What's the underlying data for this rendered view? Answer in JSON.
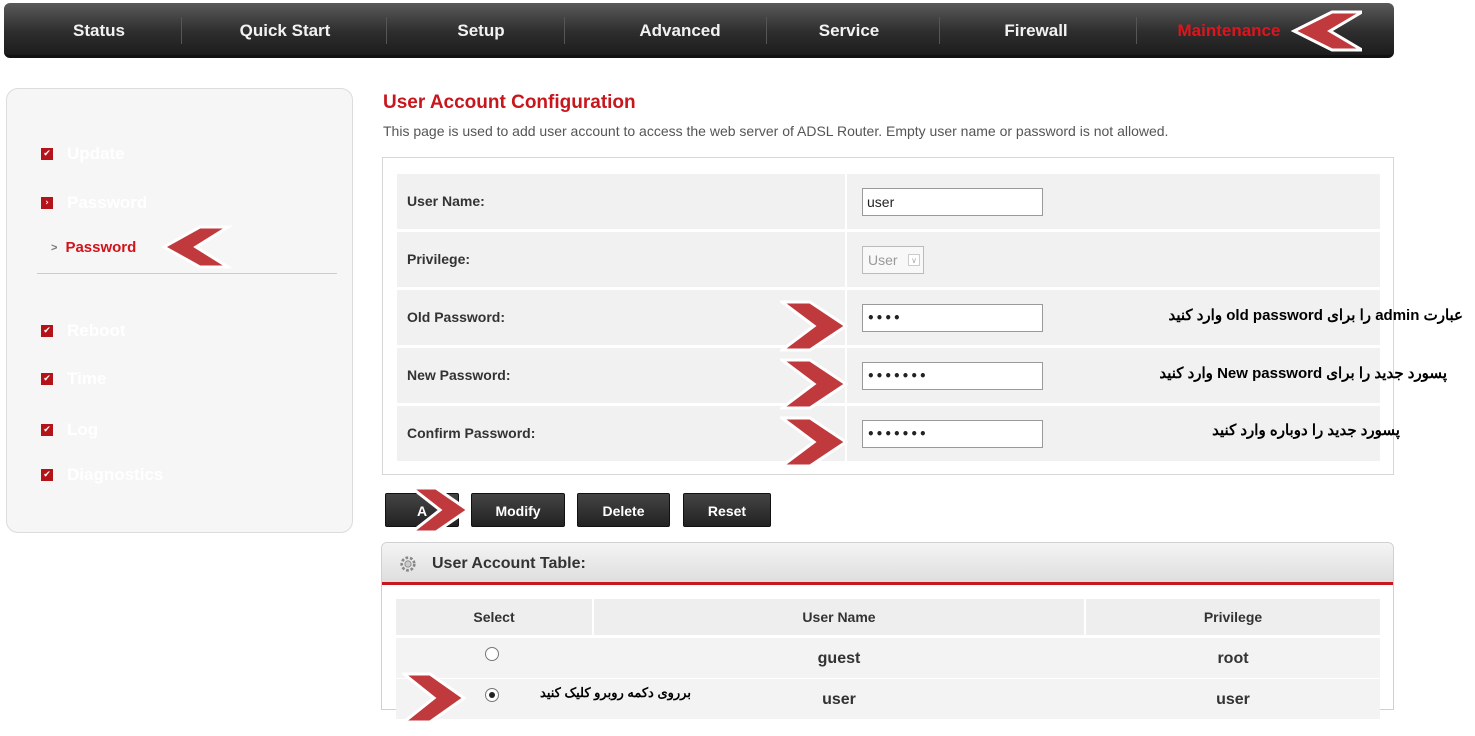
{
  "nav": {
    "items": [
      {
        "label": "Status"
      },
      {
        "label": "Quick Start"
      },
      {
        "label": "Setup"
      },
      {
        "label": "Advanced"
      },
      {
        "label": "Service"
      },
      {
        "label": "Firewall"
      },
      {
        "label": "Maintenance",
        "active": true
      }
    ]
  },
  "sidebar": {
    "items": [
      {
        "label": "Update"
      },
      {
        "label": "Password"
      },
      {
        "label": "Reboot"
      },
      {
        "label": "Time"
      },
      {
        "label": "Log"
      },
      {
        "label": "Diagnostics"
      }
    ],
    "sub_item": "Password"
  },
  "page": {
    "title": "User Account Configuration",
    "description": "This page is used to add user account to access the web server of ADSL Router. Empty user name or password is not allowed."
  },
  "form": {
    "user_name_label": "User Name:",
    "user_name_value": "user",
    "privilege_label": "Privilege:",
    "privilege_value": "User",
    "old_password_label": "Old Password:",
    "old_password_value": "••••",
    "new_password_label": "New Password:",
    "new_password_value": "•••••••",
    "confirm_password_label": "Confirm Password:",
    "confirm_password_value": "•••••••"
  },
  "notes": {
    "old_password": "عبارت admin را  برای old password وارد کنید",
    "new_password": "پسورد جدید را برای New password وارد کنید",
    "confirm_password": "پسورد جدید را دوباره وارد کنید",
    "select_radio": "برروی دکمه روبرو کلیک کنید"
  },
  "buttons": {
    "add": "A",
    "modify": "Modify",
    "delete": "Delete",
    "reset": "Reset"
  },
  "table": {
    "title": "User Account Table:",
    "columns": [
      "Select",
      "User Name",
      "Privilege"
    ],
    "rows": [
      {
        "user_name": "guest",
        "privilege": "root",
        "selected": false
      },
      {
        "user_name": "user",
        "privilege": "user",
        "selected": true
      }
    ]
  },
  "colors": {
    "accent": "#c8161d",
    "nav_bg": "#2e2e2e",
    "annotation_arrow": "#c0393c"
  },
  "icons": [
    "settings-gear-icon",
    "checkbox-bullet-icon",
    "chevron-annotation-icon"
  ]
}
